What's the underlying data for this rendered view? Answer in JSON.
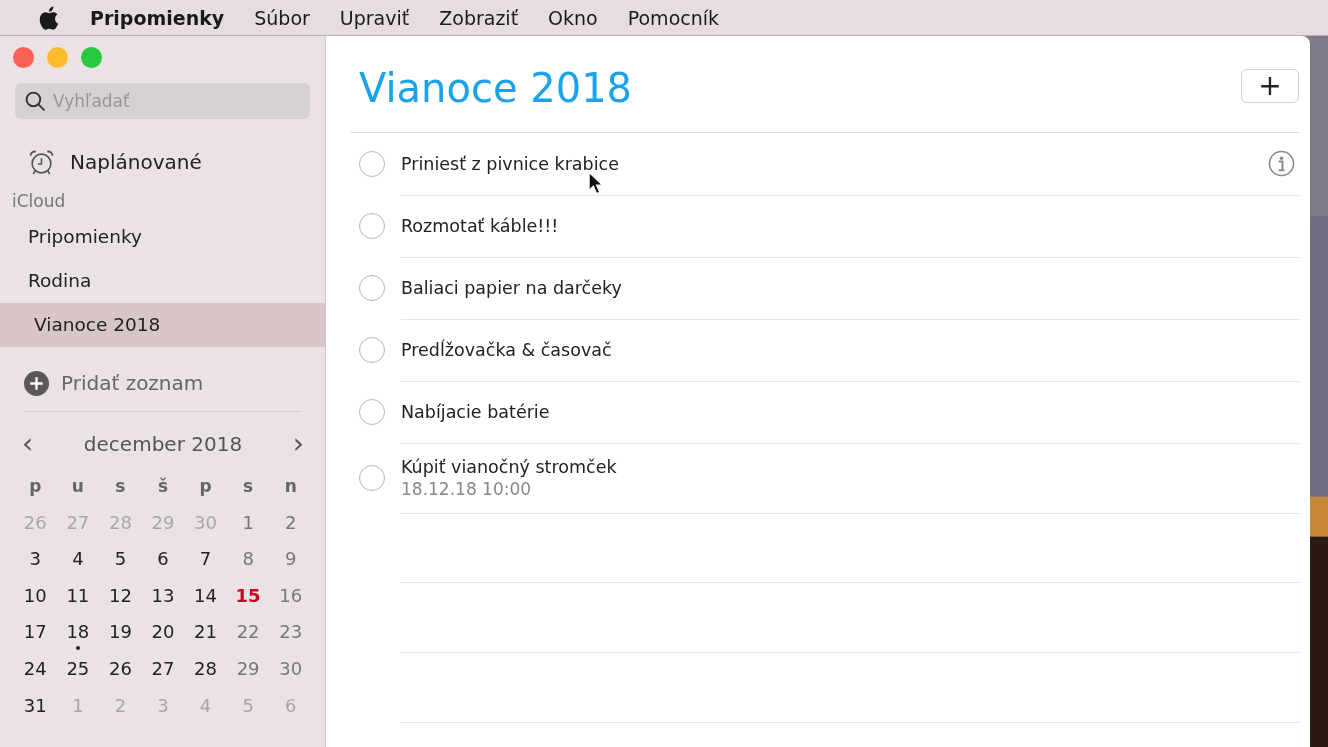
{
  "menu_bar": {
    "app_name": "Pripomienky",
    "items": [
      "Súbor",
      "Upraviť",
      "Zobraziť",
      "Okno",
      "Pomocník"
    ]
  },
  "sidebar": {
    "search": {
      "placeholder": "Vyhľadať"
    },
    "scheduled": {
      "label": "Naplánované"
    },
    "section": "iCloud",
    "lists": [
      {
        "label": "Pripomienky",
        "selected": false
      },
      {
        "label": "Rodina",
        "selected": false
      },
      {
        "label": "Vianoce 2018",
        "selected": true
      }
    ],
    "add_list": "Pridať zoznam",
    "calendar": {
      "month": "december 2018",
      "prev": "‹",
      "next": "›",
      "weekdays": [
        "p",
        "u",
        "s",
        "š",
        "p",
        "s",
        "n"
      ],
      "days": [
        {
          "d": "26",
          "other": true,
          "today": false,
          "event": false
        },
        {
          "d": "27",
          "other": true,
          "today": false,
          "event": false
        },
        {
          "d": "28",
          "other": true,
          "today": false,
          "event": false
        },
        {
          "d": "29",
          "other": true,
          "today": false,
          "event": false
        },
        {
          "d": "30",
          "other": true,
          "today": false,
          "event": false
        },
        {
          "d": "1",
          "other": false,
          "today": false,
          "event": false
        },
        {
          "d": "2",
          "other": false,
          "today": false,
          "event": false
        },
        {
          "d": "3",
          "other": false,
          "today": false,
          "event": false
        },
        {
          "d": "4",
          "other": false,
          "today": false,
          "event": false
        },
        {
          "d": "5",
          "other": false,
          "today": false,
          "event": false
        },
        {
          "d": "6",
          "other": false,
          "today": false,
          "event": false
        },
        {
          "d": "7",
          "other": false,
          "today": false,
          "event": false
        },
        {
          "d": "8",
          "other": false,
          "today": false,
          "event": false
        },
        {
          "d": "9",
          "other": false,
          "today": false,
          "event": false
        },
        {
          "d": "10",
          "other": false,
          "today": false,
          "event": false
        },
        {
          "d": "11",
          "other": false,
          "today": false,
          "event": false
        },
        {
          "d": "12",
          "other": false,
          "today": false,
          "event": false
        },
        {
          "d": "13",
          "other": false,
          "today": false,
          "event": false
        },
        {
          "d": "14",
          "other": false,
          "today": false,
          "event": false
        },
        {
          "d": "15",
          "other": false,
          "today": true,
          "event": false
        },
        {
          "d": "16",
          "other": false,
          "today": false,
          "event": false
        },
        {
          "d": "17",
          "other": false,
          "today": false,
          "event": false
        },
        {
          "d": "18",
          "other": false,
          "today": false,
          "event": true
        },
        {
          "d": "19",
          "other": false,
          "today": false,
          "event": false
        },
        {
          "d": "20",
          "other": false,
          "today": false,
          "event": false
        },
        {
          "d": "21",
          "other": false,
          "today": false,
          "event": false
        },
        {
          "d": "22",
          "other": false,
          "today": false,
          "event": false
        },
        {
          "d": "23",
          "other": false,
          "today": false,
          "event": false
        },
        {
          "d": "24",
          "other": false,
          "today": false,
          "event": false
        },
        {
          "d": "25",
          "other": false,
          "today": false,
          "event": false
        },
        {
          "d": "26",
          "other": false,
          "today": false,
          "event": false
        },
        {
          "d": "27",
          "other": false,
          "today": false,
          "event": false
        },
        {
          "d": "28",
          "other": false,
          "today": false,
          "event": false
        },
        {
          "d": "29",
          "other": false,
          "today": false,
          "event": false
        },
        {
          "d": "30",
          "other": false,
          "today": false,
          "event": false
        },
        {
          "d": "31",
          "other": false,
          "today": false,
          "event": false
        },
        {
          "d": "1",
          "other": true,
          "today": false,
          "event": false
        },
        {
          "d": "2",
          "other": true,
          "today": false,
          "event": false
        },
        {
          "d": "3",
          "other": true,
          "today": false,
          "event": false
        },
        {
          "d": "4",
          "other": true,
          "today": false,
          "event": false
        },
        {
          "d": "5",
          "other": true,
          "today": false,
          "event": false
        },
        {
          "d": "6",
          "other": true,
          "today": false,
          "event": false
        }
      ]
    }
  },
  "main": {
    "title": "Vianoce 2018",
    "add_button": "+",
    "reminders": [
      {
        "title": "Priniesť z pivnice krabice",
        "checked": false,
        "info": true
      },
      {
        "title": "Rozmotať káble!!!",
        "checked": false,
        "info": false
      },
      {
        "title": "Baliaci papier na darčeky",
        "checked": false,
        "info": false
      },
      {
        "title": "Predĺžovačka & časovač",
        "checked": false,
        "info": false
      },
      {
        "title": "Nabíjacie batérie",
        "checked": false,
        "info": false
      },
      {
        "title": "Kúpiť vianočný stromček",
        "date": "18.12.18 10:00",
        "checked": false,
        "info": false
      }
    ]
  }
}
